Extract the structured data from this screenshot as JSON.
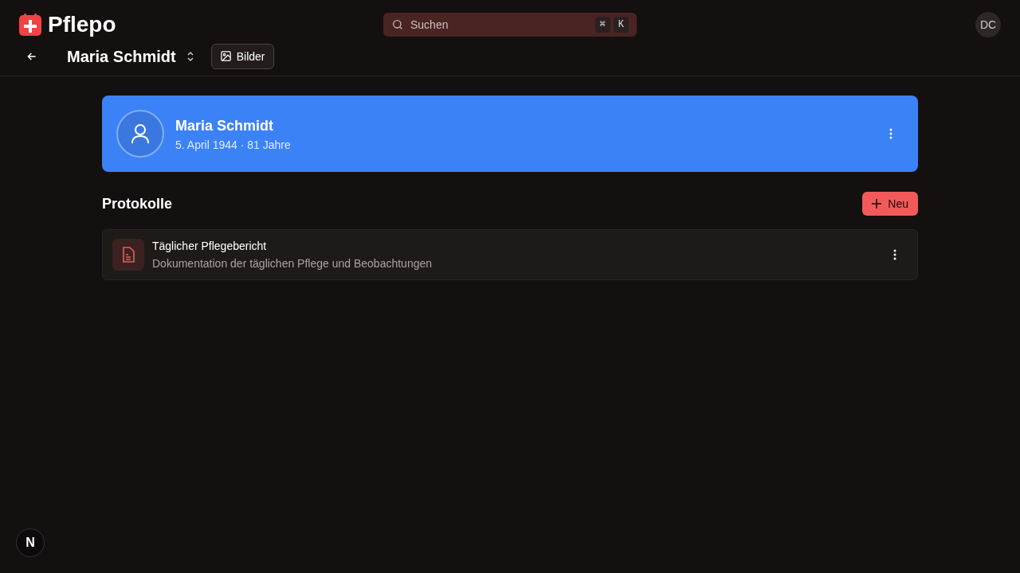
{
  "header": {
    "app_name": "Pflepo",
    "search": {
      "placeholder": "Suchen",
      "shortcut_keys": [
        "⌘",
        "K"
      ]
    },
    "user_initials": "DC"
  },
  "toolbar": {
    "title": "Maria Schmidt",
    "images_button": "Bilder"
  },
  "profile": {
    "name": "Maria Schmidt",
    "details": "5. April 1944 · 81 Jahre"
  },
  "protocols": {
    "heading": "Protokolle",
    "new_button": "Neu",
    "items": [
      {
        "title": "Täglicher Pflegebericht",
        "description": "Dokumentation der täglichen Pflege und Beobachtungen"
      }
    ]
  },
  "dev_badge": "N"
}
